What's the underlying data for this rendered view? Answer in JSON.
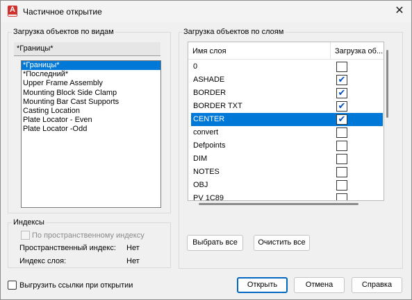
{
  "window": {
    "title": "Частичное открытие",
    "app_icon_letter": "A",
    "close_glyph": "✕"
  },
  "views_group": {
    "title": "Загрузка объектов по видам",
    "current_value": "*Границы*",
    "items": [
      {
        "label": "*Границы*",
        "selected": true
      },
      {
        "label": "*Последний*",
        "selected": false
      },
      {
        "label": "Upper Frame Assembly",
        "selected": false
      },
      {
        "label": "Mounting Block Side Clamp",
        "selected": false
      },
      {
        "label": "Mounting Bar Cast Supports",
        "selected": false
      },
      {
        "label": "Casting Location",
        "selected": false
      },
      {
        "label": "Plate Locator - Even",
        "selected": false
      },
      {
        "label": "Plate Locator -Odd",
        "selected": false
      }
    ]
  },
  "indexes_group": {
    "title": "Индексы",
    "spatial_checkbox_label": "По пространственному индексу",
    "spatial_index_label": "Пространственный индекс:",
    "spatial_index_value": "Нет",
    "layer_index_label": "Индекс слоя:",
    "layer_index_value": "Нет"
  },
  "layers_group": {
    "title": "Загрузка объектов по слоям",
    "col_name": "Имя слоя",
    "col_load": "Загрузка об...",
    "rows": [
      {
        "name": "0",
        "checked": false,
        "selected": false
      },
      {
        "name": "ASHADE",
        "checked": true,
        "selected": false
      },
      {
        "name": "BORDER",
        "checked": true,
        "selected": false
      },
      {
        "name": "BORDER TXT",
        "checked": true,
        "selected": false
      },
      {
        "name": "CENTER",
        "checked": true,
        "selected": true
      },
      {
        "name": "convert",
        "checked": false,
        "selected": false
      },
      {
        "name": "Defpoints",
        "checked": false,
        "selected": false
      },
      {
        "name": "DIM",
        "checked": false,
        "selected": false
      },
      {
        "name": "NOTES",
        "checked": false,
        "selected": false
      },
      {
        "name": "OBJ",
        "checked": false,
        "selected": false
      },
      {
        "name": "PV 1C89",
        "checked": false,
        "selected": false
      }
    ],
    "select_all_label": "Выбрать все",
    "clear_all_label": "Очистить все"
  },
  "footer": {
    "unload_xrefs_label": "Выгрузить ссылки при открытии",
    "open_label": "Открыть",
    "cancel_label": "Отмена",
    "help_label": "Справка"
  },
  "colors": {
    "selection": "#0078d7",
    "checkmark": "#0050c8",
    "primary_button_border": "#0067c0"
  }
}
